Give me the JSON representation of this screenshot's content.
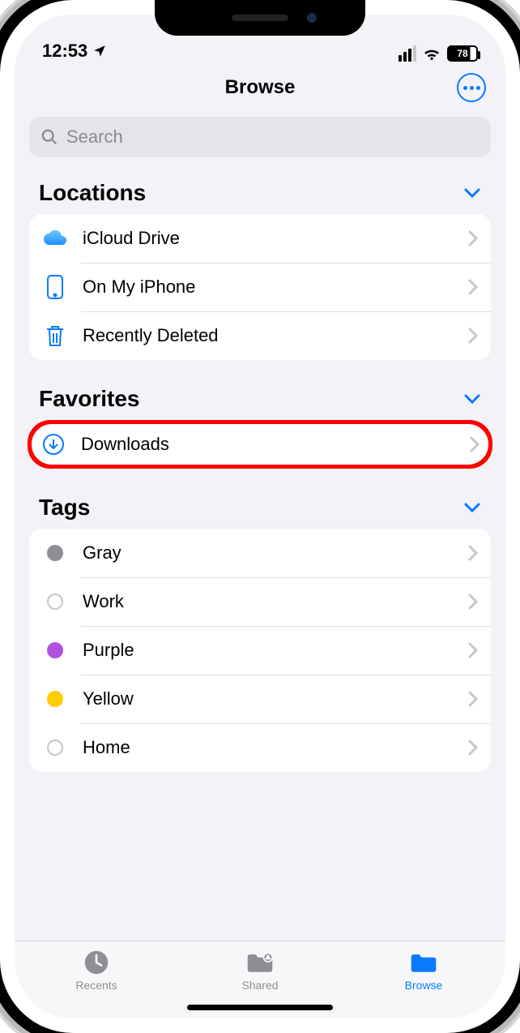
{
  "status": {
    "time": "12:53",
    "battery": "78"
  },
  "nav": {
    "title": "Browse"
  },
  "search": {
    "placeholder": "Search"
  },
  "sections": {
    "locations": {
      "title": "Locations",
      "items": [
        {
          "label": "iCloud Drive"
        },
        {
          "label": "On My iPhone"
        },
        {
          "label": "Recently Deleted"
        }
      ]
    },
    "favorites": {
      "title": "Favorites",
      "items": [
        {
          "label": "Downloads"
        }
      ]
    },
    "tags": {
      "title": "Tags",
      "items": [
        {
          "label": "Gray",
          "color": "#8e8e93",
          "style": "filled"
        },
        {
          "label": "Work",
          "color": "#c7c7cc",
          "style": "outline"
        },
        {
          "label": "Purple",
          "color": "#af52de",
          "style": "filled"
        },
        {
          "label": "Yellow",
          "color": "#ffcc00",
          "style": "filled"
        },
        {
          "label": "Home",
          "color": "#c7c7cc",
          "style": "outline"
        }
      ]
    }
  },
  "tabs": {
    "recents": "Recents",
    "shared": "Shared",
    "browse": "Browse"
  }
}
